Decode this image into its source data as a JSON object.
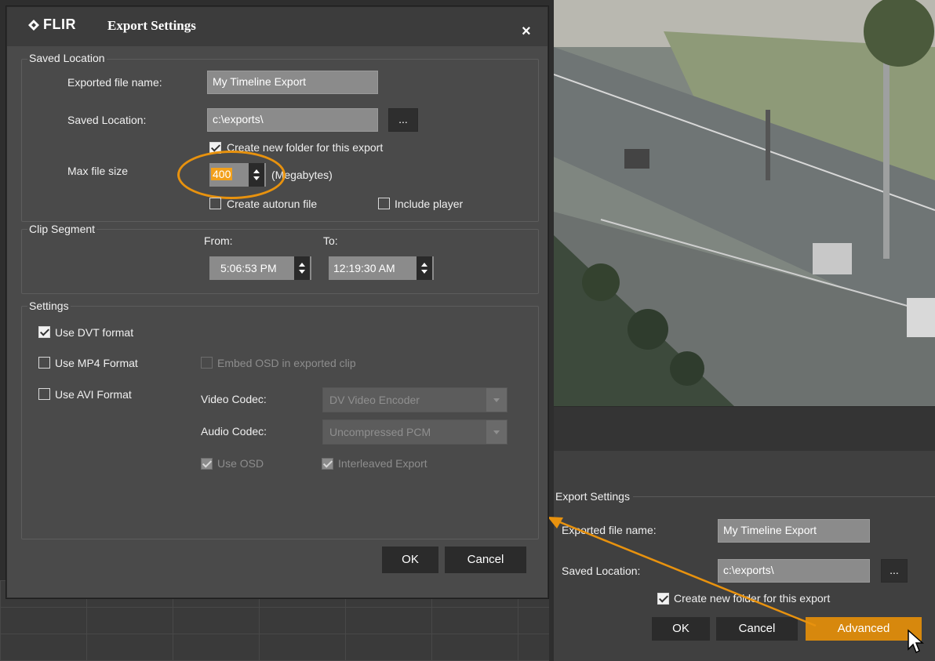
{
  "dialog": {
    "logo_text": "FLIR",
    "title": "Export Settings",
    "close_glyph": "×",
    "saved_location": {
      "legend": "Saved Location",
      "file_name_label": "Exported file name:",
      "file_name_value": "My Timeline Export",
      "location_label": "Saved Location:",
      "location_value": "c:\\exports\\",
      "browse_label": "...",
      "create_folder_label": "Create new folder for this export",
      "create_folder_checked": true,
      "max_size_label": "Max file size",
      "max_size_value": "400",
      "max_size_unit": "(Megabytes)",
      "autorun_label": "Create autorun file",
      "autorun_checked": false,
      "include_player_label": "Include player",
      "include_player_checked": false
    },
    "clip_segment": {
      "legend": "Clip Segment",
      "from_label": "From:",
      "from_value": "5:06:53 PM",
      "to_label": "To:",
      "to_value": "12:19:30 AM"
    },
    "settings": {
      "legend": "Settings",
      "dvt_label": "Use DVT format",
      "dvt_checked": true,
      "mp4_label": "Use MP4 Format",
      "mp4_checked": false,
      "avi_label": "Use AVI Format",
      "avi_checked": false,
      "embed_osd_label": "Embed OSD in exported clip",
      "video_codec_label": "Video Codec:",
      "video_codec_value": "DV Video Encoder",
      "audio_codec_label": "Audio Codec:",
      "audio_codec_value": "Uncompressed PCM",
      "use_osd_label": "Use OSD",
      "interleaved_label": "Interleaved Export"
    },
    "ok_label": "OK",
    "cancel_label": "Cancel"
  },
  "simple_panel": {
    "legend": "Export Settings",
    "file_name_label": "Exported file name:",
    "file_name_value": "My Timeline Export",
    "location_label": "Saved Location:",
    "location_value": "c:\\exports\\",
    "browse_label": "...",
    "create_folder_label": "Create new folder for this export",
    "create_folder_checked": true,
    "ok_label": "OK",
    "cancel_label": "Cancel",
    "advanced_label": "Advanced"
  },
  "annotation_color": "#e8920e",
  "accent_color": "#d7880d",
  "icons": [
    "flir-logo-icon",
    "close-icon",
    "checkbox-check-icon",
    "spinner-up-icon",
    "spinner-down-icon",
    "dropdown-arrow-icon",
    "mouse-cursor-icon",
    "annotation-arrow-icon"
  ]
}
